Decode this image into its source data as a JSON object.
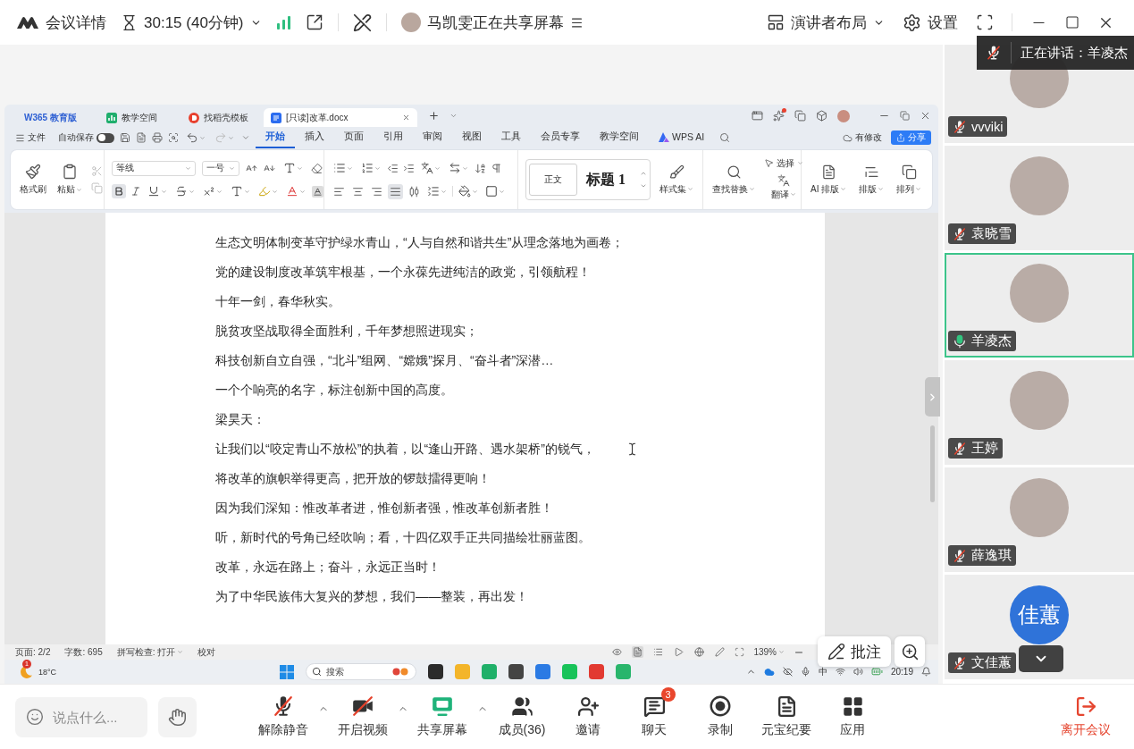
{
  "top_bar": {
    "title": "会议详情",
    "timer": "30:15 (40分钟)",
    "sharing": "马凯雯正在共享屏幕",
    "layout": "演讲者布局",
    "settings": "设置"
  },
  "wps": {
    "tabs": [
      {
        "label": "W365 教育版",
        "kind": "home",
        "selected": false
      },
      {
        "label": "教学空间",
        "kind": "space",
        "selected": false
      },
      {
        "label": "找稻壳模板",
        "kind": "template",
        "selected": false
      },
      {
        "label": "[只读]改革.docx",
        "kind": "document",
        "selected": true
      }
    ],
    "menu": {
      "file": "文件",
      "autosave": {
        "label": "自动保存",
        "on": false
      },
      "tabs": [
        {
          "label": "开始",
          "kind": "plain",
          "selected": true
        },
        {
          "label": "插入",
          "kind": "plain",
          "selected": false
        },
        {
          "label": "页面",
          "kind": "plain",
          "selected": false
        },
        {
          "label": "引用",
          "kind": "plain",
          "selected": false
        },
        {
          "label": "审阅",
          "kind": "plain",
          "selected": false
        },
        {
          "label": "视图",
          "kind": "plain",
          "selected": false
        },
        {
          "label": "工具",
          "kind": "plain",
          "selected": false
        },
        {
          "label": "会员专享",
          "kind": "plain",
          "selected": false
        },
        {
          "label": "教学空间",
          "kind": "plain",
          "selected": false
        },
        {
          "label": "WPS AI",
          "kind": "ai",
          "selected": false
        }
      ],
      "modified": "有修改",
      "share": "分享"
    },
    "ribbon": {
      "format_painter": "格式刷",
      "paste": "粘贴",
      "font": "等线",
      "size": "一号",
      "bold": true,
      "alignments": [
        {
          "kind": "left",
          "selected": false
        },
        {
          "kind": "center",
          "selected": false
        },
        {
          "kind": "right",
          "selected": false
        },
        {
          "kind": "justify",
          "selected": true
        },
        {
          "kind": "distribute",
          "selected": false
        }
      ],
      "styles": [
        {
          "label": "正文",
          "kind": "body"
        },
        {
          "label": "标题 1",
          "kind": "heading"
        }
      ],
      "style_set": "样式集",
      "find_replace": "查找替换",
      "select": "选择",
      "translate": "翻译",
      "layout_buttons": [
        {
          "label": "AI 排版",
          "kind": "ai"
        },
        {
          "label": "排版",
          "kind": "layout"
        },
        {
          "label": "排列",
          "kind": "arrange"
        }
      ]
    },
    "document": {
      "lines": [
        {
          "text": "生态文明体制变革守护绿水青山，“人与自然和谐共生”从理念落地为画卷；",
          "kind": "body"
        },
        {
          "text": "党的建设制度改革筑牢根基，一个永葆先进纯洁的政党，引领航程！",
          "kind": "body"
        },
        {
          "text": "十年一剑，春华秋实。",
          "kind": "body"
        },
        {
          "text": "脱贫攻坚战取得全面胜利，千年梦想照进现实；",
          "kind": "body"
        },
        {
          "text": "科技创新自立自强，“北斗”组网、“嫦娥”探月、“奋斗者”深潜…",
          "kind": "body"
        },
        {
          "text": "一个个响亮的名字，标注创新中国的高度。",
          "kind": "body"
        },
        {
          "text": "梁昊天：",
          "kind": "speaker"
        },
        {
          "text": "让我们以“咬定青山不放松”的执着，以“逢山开路、遇水架桥”的锐气，",
          "kind": "body"
        },
        {
          "text": "将改革的旗帜举得更高，把开放的锣鼓擂得更响！",
          "kind": "body"
        },
        {
          "text": "因为我们深知：惟改革者进，惟创新者强，惟改革创新者胜！",
          "kind": "body"
        },
        {
          "text": "听，新时代的号角已经吹响；看，十四亿双手正共同描绘壮丽蓝图。",
          "kind": "body"
        },
        {
          "text": "改革，永远在路上；奋斗，永远正当时！",
          "kind": "body"
        },
        {
          "text": "为了中华民族伟大复兴的梦想，我们——整装，再出发！",
          "kind": "body"
        }
      ]
    },
    "status_bar": {
      "page": "页面: 2/2",
      "words": "字数: 695",
      "spellcheck": "拼写检查: 打开",
      "proofread": "校对",
      "views": [
        {
          "kind": "read",
          "selected": false
        },
        {
          "kind": "page",
          "selected": true
        },
        {
          "kind": "outline",
          "selected": false
        },
        {
          "kind": "play",
          "selected": false
        },
        {
          "kind": "web",
          "selected": false
        },
        {
          "kind": "pen",
          "selected": false
        }
      ],
      "zoom": "139%"
    }
  },
  "taskbar": {
    "weather_badge": "1",
    "temperature": "18°C",
    "search_placeholder": "搜索",
    "input_method": "中",
    "time": "20:19"
  },
  "speaking": "正在讲话：羊凌杰",
  "participants": [
    {
      "name": "vvviki",
      "kind": "photo",
      "muted": true,
      "selected": false
    },
    {
      "name": "袁晓雪",
      "kind": "photo",
      "muted": true,
      "selected": false
    },
    {
      "name": "羊凌杰",
      "kind": "photo",
      "muted": false,
      "selected": true
    },
    {
      "name": "王婷",
      "kind": "photo",
      "muted": true,
      "selected": false
    },
    {
      "name": "薛逸琪",
      "kind": "photo",
      "muted": true,
      "selected": false
    },
    {
      "name": "文佳蕙",
      "kind": "initials",
      "avatar_text": "佳蕙",
      "muted": true,
      "selected": false
    }
  ],
  "annotate": "批注",
  "toolbar": {
    "chat_placeholder": "说点什么...",
    "buttons": [
      {
        "kind": "mic_off",
        "label": "解除静音",
        "menu": true
      },
      {
        "kind": "video_off",
        "label": "开启视频",
        "menu": true
      },
      {
        "kind": "share",
        "label": "共享屏幕",
        "menu": true
      },
      {
        "kind": "members",
        "label": "成员(36)",
        "menu": false
      },
      {
        "kind": "invite",
        "label": "邀请",
        "menu": false
      },
      {
        "kind": "chat",
        "label": "聊天",
        "menu": false,
        "badge": "3"
      },
      {
        "kind": "record",
        "label": "录制",
        "menu": false
      },
      {
        "kind": "summary",
        "label": "元宝纪要",
        "menu": false
      },
      {
        "kind": "apps",
        "label": "应用",
        "menu": false
      }
    ],
    "leave": "离开会议"
  }
}
